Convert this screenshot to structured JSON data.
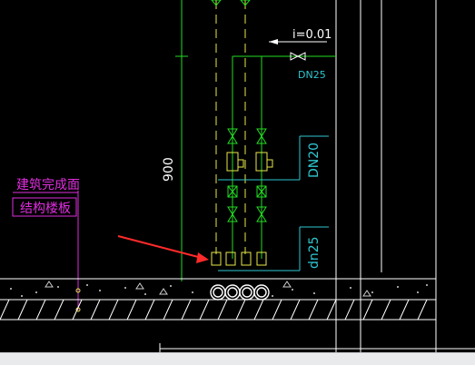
{
  "window": {
    "title": ""
  },
  "drawing": {
    "labels": {
      "slope": "i=0.01",
      "dn25_top": "DN25",
      "dim_900": "900",
      "dn20": "DN20",
      "dn25_low": "dn25",
      "finish_floor": "建筑完成面",
      "structure_slab": "结构楼板"
    },
    "colors": {
      "background": "#000000",
      "white_lines": "#ffffff",
      "pipe_green": "#22dd22",
      "dashed_yellow": "#e8e84a",
      "cyan_text": "#2ec8d2",
      "magenta_label": "#e02ee0",
      "red_arrow": "#ff2a2a",
      "status_bar": "#e9eaec"
    },
    "icons": [
      "gate-valve-icon",
      "ball-valve-icon",
      "check-valve-icon",
      "pipe-coil-icon",
      "arrow-pointer-icon"
    ]
  }
}
